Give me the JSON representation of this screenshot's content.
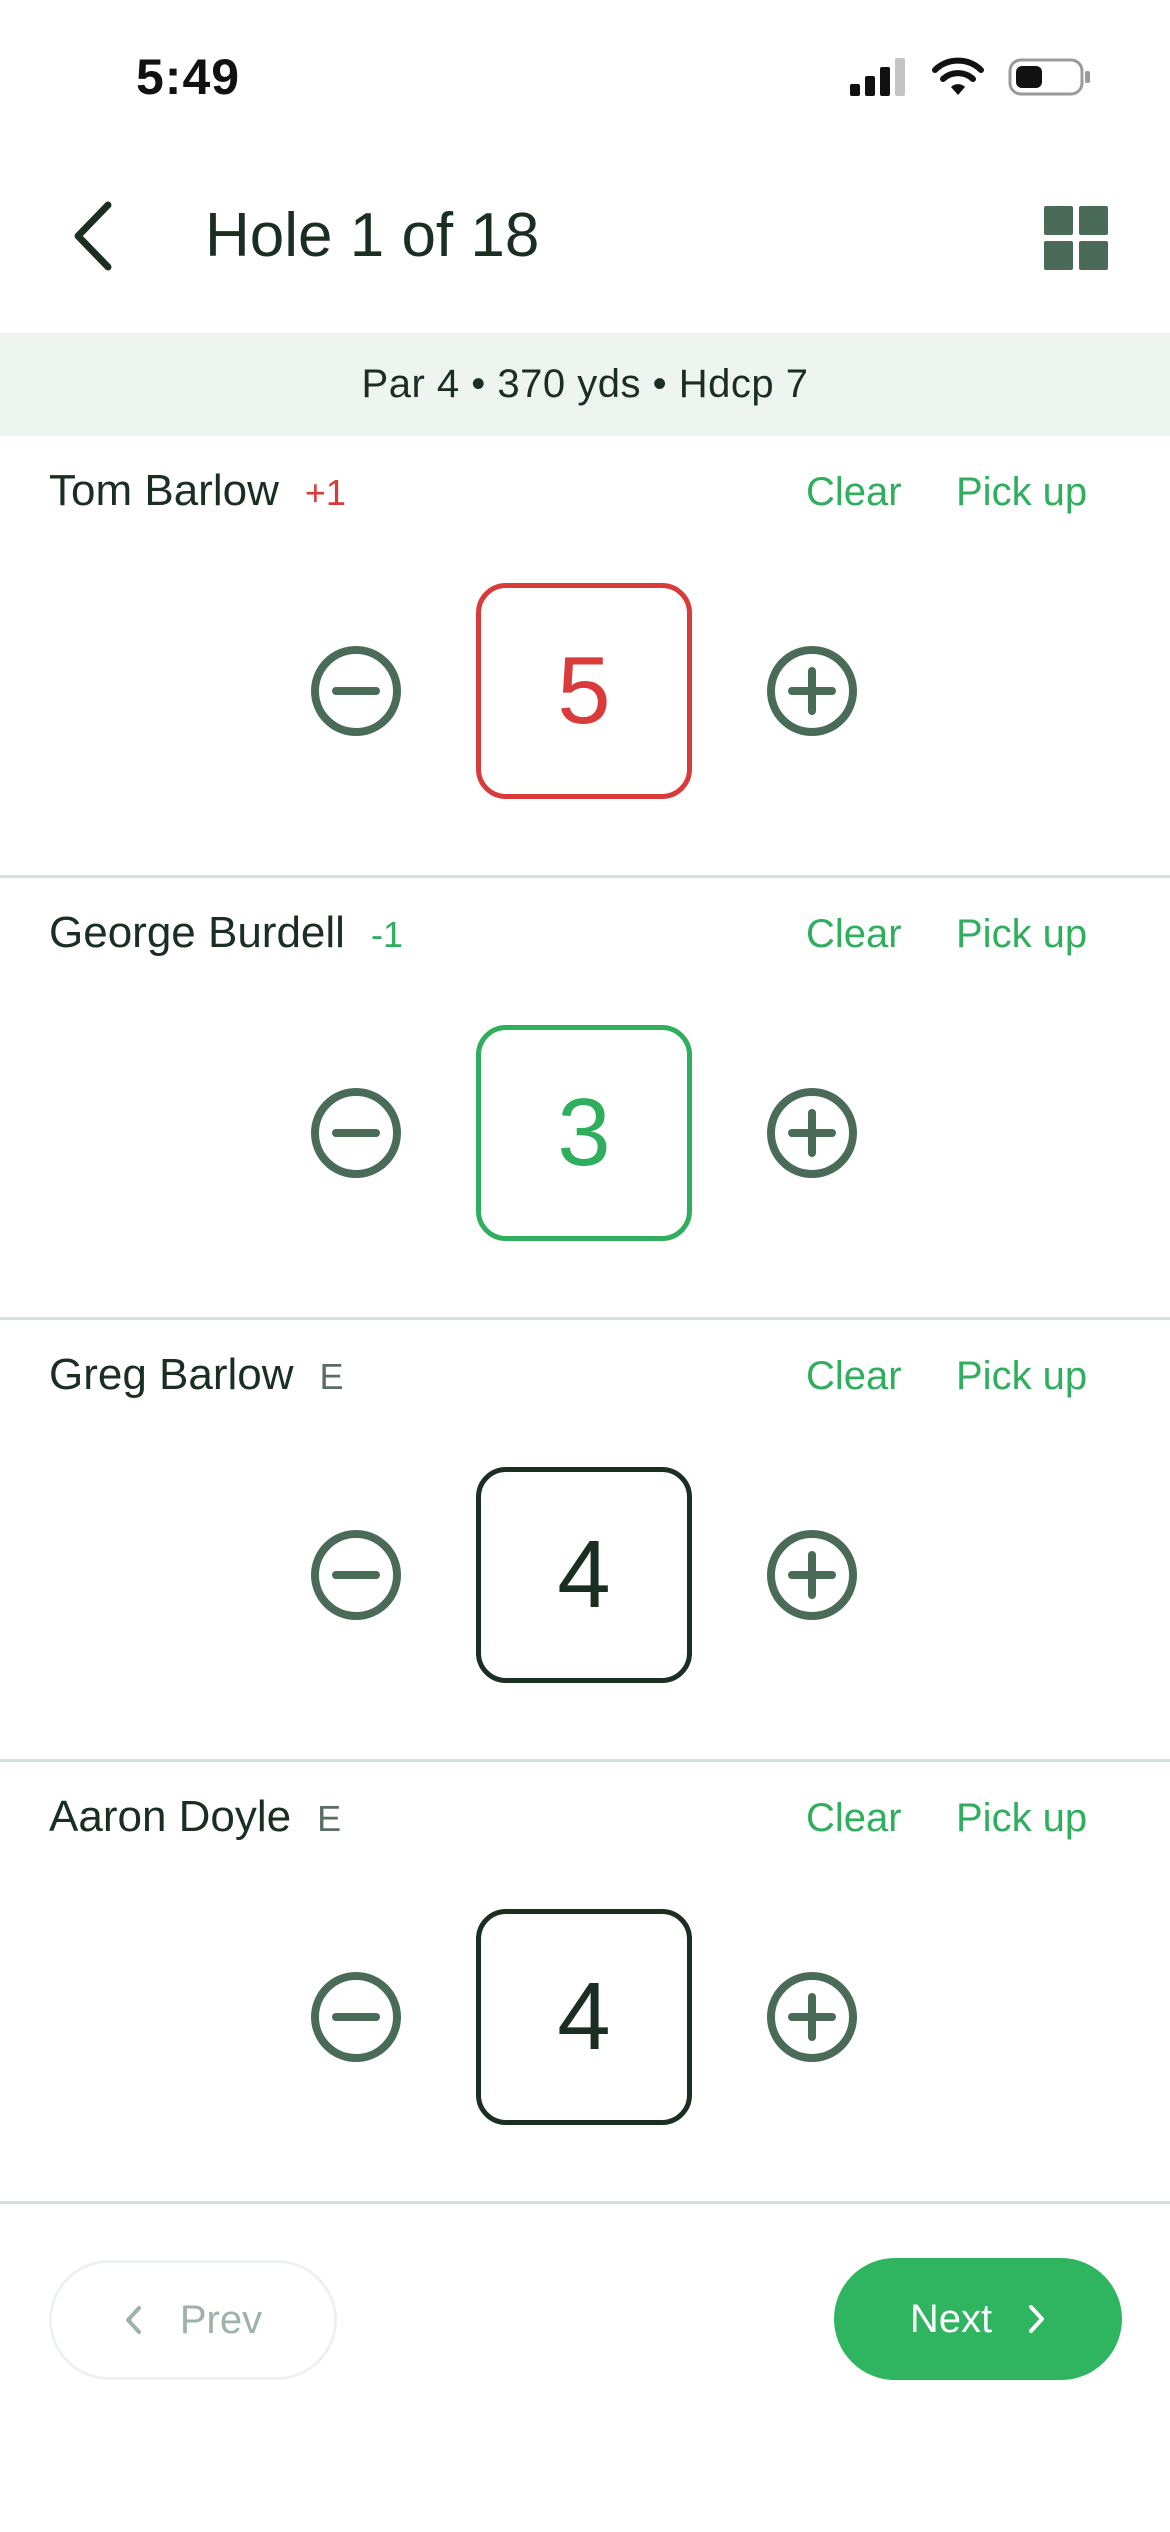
{
  "status_bar": {
    "time": "5:49",
    "icons": [
      "cellular-signal-icon",
      "wifi-icon",
      "battery-icon"
    ]
  },
  "header": {
    "back_icon": "chevron-left-icon",
    "title": "Hole 1 of 18",
    "grid_icon": "grid-view-icon"
  },
  "hole_info": {
    "text": "Par 4 • 370 yds • Hdcp 7"
  },
  "players": [
    {
      "name": "Tom Barlow",
      "rel_par": "+1",
      "score": "5",
      "status": "over",
      "clear_label": "Clear",
      "pickup_label": "Pick up"
    },
    {
      "name": "George Burdell",
      "rel_par": "-1",
      "score": "3",
      "status": "under",
      "clear_label": "Clear",
      "pickup_label": "Pick up"
    },
    {
      "name": "Greg Barlow",
      "rel_par": "E",
      "score": "4",
      "status": "even",
      "clear_label": "Clear",
      "pickup_label": "Pick up"
    },
    {
      "name": "Aaron Doyle",
      "rel_par": "E",
      "score": "4",
      "status": "even",
      "clear_label": "Clear",
      "pickup_label": "Pick up"
    }
  ],
  "footer": {
    "prev_label": "Prev",
    "next_label": "Next",
    "prev_enabled": false
  },
  "colors": {
    "accent_green": "#2fb560",
    "over_par_red": "#d93b3b",
    "under_par_green": "#2fae5e",
    "icon_dark_green": "#4a6b58",
    "banner_bg": "#eef5f1"
  }
}
